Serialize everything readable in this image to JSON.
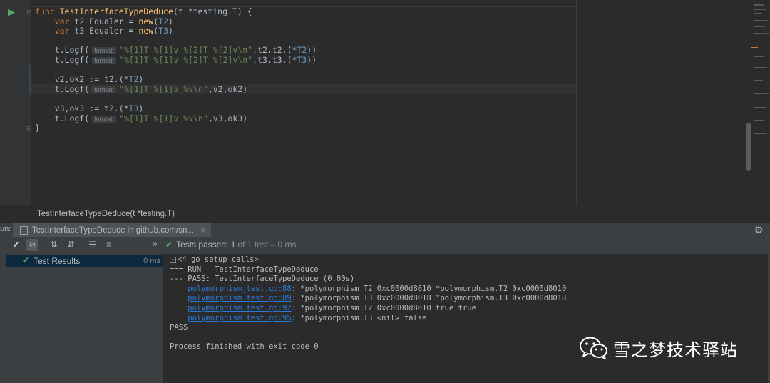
{
  "editor": {
    "lines": [
      {
        "parts": [
          [
            "kw",
            "func "
          ],
          [
            "fn",
            "TestInterfaceTypeDeduce"
          ],
          [
            "",
            "(t *testing.T) {"
          ]
        ]
      },
      {
        "parts": [
          [
            "",
            "    "
          ],
          [
            "kw",
            "var "
          ],
          [
            "",
            "t2 Equaler = "
          ],
          [
            "fn",
            "new"
          ],
          [
            "",
            "("
          ],
          [
            "ty",
            "T2"
          ],
          [
            "",
            ")"
          ]
        ]
      },
      {
        "parts": [
          [
            "",
            "    "
          ],
          [
            "kw",
            "var "
          ],
          [
            "",
            "t3 Equaler = "
          ],
          [
            "fn",
            "new"
          ],
          [
            "",
            "("
          ],
          [
            "ty",
            "T3"
          ],
          [
            "",
            ")"
          ]
        ]
      },
      {
        "parts": []
      },
      {
        "parts": [
          [
            "",
            "    t.Logf("
          ],
          [
            "hint",
            "format:"
          ],
          [
            "st",
            "\"%[1]T %[1]v %[2]T %[2]v\\n\""
          ],
          [
            "",
            ",t2,t2.(*"
          ],
          [
            "ty",
            "T2"
          ],
          [
            "",
            "))"
          ]
        ]
      },
      {
        "parts": [
          [
            "",
            "    t.Logf("
          ],
          [
            "hint",
            "format:"
          ],
          [
            "st",
            "\"%[1]T %[1]v %[2]T %[2]v\\n\""
          ],
          [
            "",
            ",t3,t3.(*"
          ],
          [
            "ty",
            "T3"
          ],
          [
            "",
            "))"
          ]
        ]
      },
      {
        "parts": []
      },
      {
        "parts": [
          [
            "",
            "    v2,ok2 := t2.(*"
          ],
          [
            "ty",
            "T2"
          ],
          [
            "",
            ")"
          ]
        ]
      },
      {
        "parts": [
          [
            "",
            "    t.Logf("
          ],
          [
            "hint",
            "format:"
          ],
          [
            "st",
            "\"%[1]T %[1]v %v\\n\""
          ],
          [
            "",
            ",v2,ok2)"
          ]
        ]
      },
      {
        "parts": []
      },
      {
        "parts": [
          [
            "",
            "    v3,ok3 := t2.(*"
          ],
          [
            "ty",
            "T3"
          ],
          [
            "",
            ")"
          ]
        ]
      },
      {
        "parts": [
          [
            "",
            "    t.Logf("
          ],
          [
            "hint",
            "format:"
          ],
          [
            "st",
            "\"%[1]T %[1]v %v\\n\""
          ],
          [
            "",
            ",v3,ok3)"
          ]
        ]
      },
      {
        "parts": [
          [
            "",
            "}"
          ]
        ]
      }
    ]
  },
  "breadcrumb": "TestInterfaceTypeDeduce(t *testing.T)",
  "run_window": {
    "label": "un:",
    "tab_title": "TestInterfaceTypeDeduce in github.com/sn...",
    "status_prefix": "Tests passed:",
    "status_count": "1",
    "status_suffix": "of 1 test – 0 ms",
    "tree": {
      "label": "Test Results",
      "duration": "0 ms"
    }
  },
  "console": {
    "setup": "<4 go setup calls>",
    "lines": [
      {
        "text": "=== RUN   TestInterfaceTypeDeduce"
      },
      {
        "text": "--- PASS: TestInterfaceTypeDeduce (0.00s)"
      },
      {
        "link": "polymorphism_test.go:88",
        "text": ": *polymorphism.T2 0xc0000d8010 *polymorphism.T2 0xc0000d8010"
      },
      {
        "link": "polymorphism_test.go:89",
        "text": ": *polymorphism.T3 0xc0000d8018 *polymorphism.T3 0xc0000d8018"
      },
      {
        "link": "polymorphism_test.go:92",
        "text": ": *polymorphism.T2 0xc0000d8010 true true"
      },
      {
        "link": "polymorphism_test.go:95",
        "text": ": *polymorphism.T3 <nil> false"
      },
      {
        "text": "PASS"
      },
      {
        "text": ""
      },
      {
        "text": "Process finished with exit code 0"
      }
    ]
  },
  "watermark": "雪之梦技术驿站",
  "colors": {
    "accent_green": "#59a869",
    "link": "#287bde",
    "keyword": "#cc7832",
    "function": "#ffc66d"
  }
}
